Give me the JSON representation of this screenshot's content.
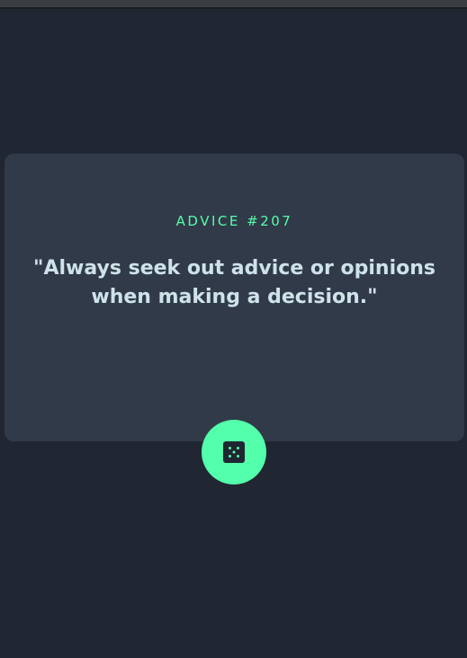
{
  "advice": {
    "label": "ADVICE #207",
    "quote": "\"Always seek out advice or opinions when making a decision.\""
  },
  "button": {
    "icon": "dice-icon"
  },
  "colors": {
    "background": "#202632",
    "card": "#313a48",
    "accent": "#53ffaa",
    "text": "#cee3e9"
  }
}
